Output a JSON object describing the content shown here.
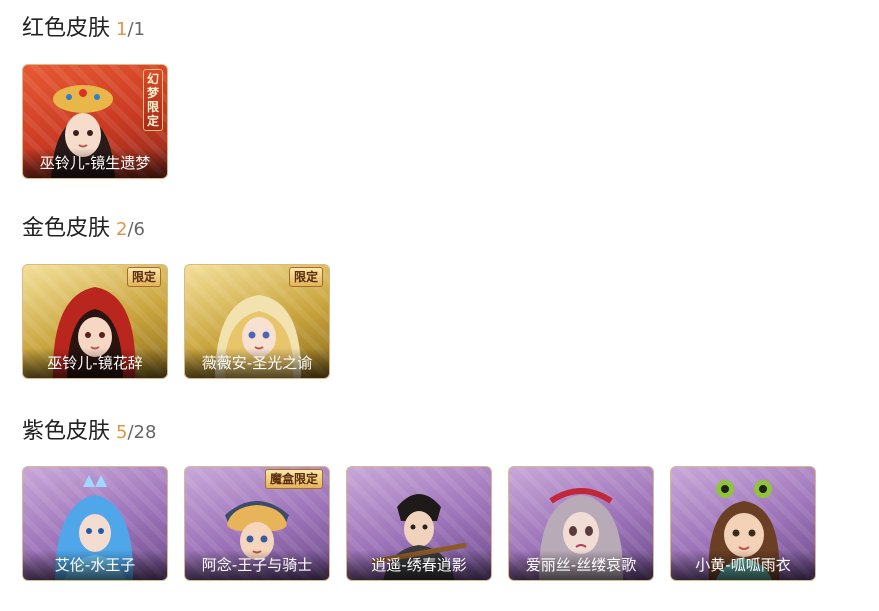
{
  "sections": [
    {
      "title": "红色皮肤",
      "owned": "1",
      "total": "/1",
      "theme": "#e0954a",
      "cards": [
        {
          "label": "巫铃儿-镜生遗梦",
          "tag": "幻梦限定",
          "icon": "character-portrait"
        }
      ]
    },
    {
      "title": "金色皮肤",
      "owned": "2",
      "total": "/6",
      "cards": [
        {
          "label": "巫铃儿-镜花辞",
          "tag": "限定",
          "icon": "character-portrait"
        },
        {
          "label": "薇薇安-圣光之谕",
          "tag": "限定",
          "icon": "character-portrait"
        }
      ]
    },
    {
      "title": "紫色皮肤",
      "owned": "5",
      "total": "/28",
      "cards": [
        {
          "label": "艾伦-水王子",
          "icon": "character-portrait"
        },
        {
          "label": "阿念-王子与骑士",
          "tag": "魔盒限定",
          "icon": "character-portrait"
        },
        {
          "label": "逍遥-绣春逍影",
          "icon": "character-portrait"
        },
        {
          "label": "爱丽丝-丝缕哀歌",
          "icon": "character-portrait"
        },
        {
          "label": "小黄-呱呱雨衣",
          "icon": "character-portrait"
        }
      ]
    }
  ],
  "colors": {
    "owned": "#e0954a",
    "red": "#c93a22",
    "gold": "#c9a43c",
    "purple": "#9c72b8"
  }
}
